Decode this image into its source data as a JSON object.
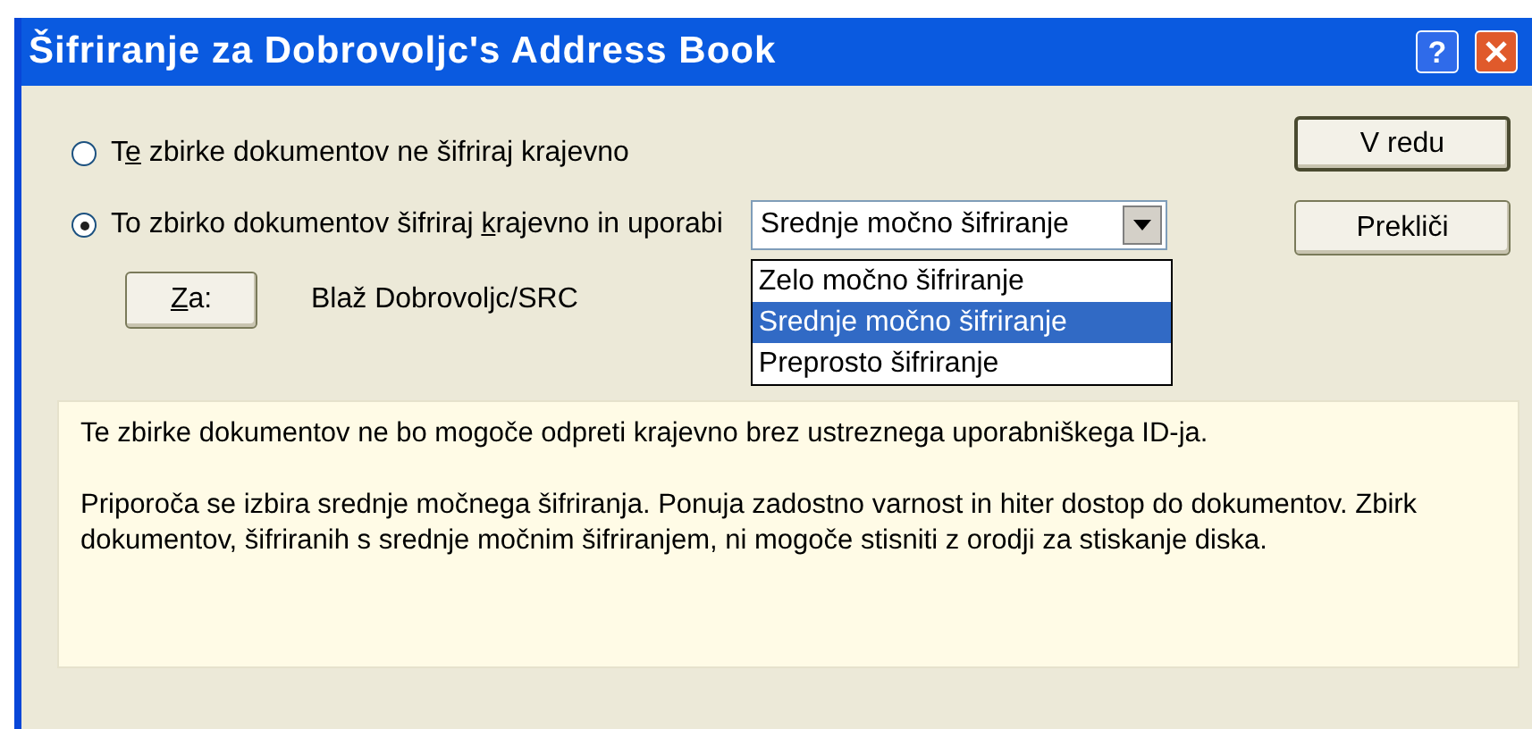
{
  "window": {
    "title": "Šifriranje za Dobrovoljc's Address Book"
  },
  "title_buttons": [
    {
      "kind": "help",
      "label": "?"
    },
    {
      "kind": "close"
    }
  ],
  "options": [
    {
      "label": [
        {
          "text": "T",
          "accel": false
        },
        {
          "text": "e",
          "accel": true
        },
        {
          "text": " zbirke dokumentov ne šifriraj krajevno",
          "accel": false
        }
      ],
      "selected": false
    },
    {
      "label": [
        {
          "text": "To zbirko dokumentov šifriraj ",
          "accel": false
        },
        {
          "text": "k",
          "accel": true
        },
        {
          "text": "rajevno in uporabi",
          "accel": false
        }
      ],
      "selected": true
    }
  ],
  "encryption_select": {
    "value": "Srednje močno šifriranje",
    "expanded": true,
    "options": [
      {
        "label": "Zelo močno šifriranje",
        "selected": false
      },
      {
        "label": "Srednje močno šifriranje",
        "selected": true
      },
      {
        "label": "Preprosto šifriranje",
        "selected": false
      }
    ]
  },
  "for_button": {
    "label": [
      {
        "text": "Z",
        "accel": true
      },
      {
        "text": "a:",
        "accel": false
      }
    ]
  },
  "user": "Blaž Dobrovoljc/SRC",
  "buttons": [
    {
      "label": "V redu",
      "default": true
    },
    {
      "label": "Prekliči",
      "default": false
    }
  ],
  "info": [
    "Te zbirke dokumentov ne bo mogoče odpreti krajevno brez ustreznega uporabniškega ID-ja.",
    "Priporoča se izbira srednje močnega šifriranja. Ponuja zadostno varnost in hiter dostop do dokumentov. Zbirk dokumentov, šifriranih s srednje močnim šifriranjem, ni mogoče stisniti z orodji za stiskanje diska."
  ]
}
